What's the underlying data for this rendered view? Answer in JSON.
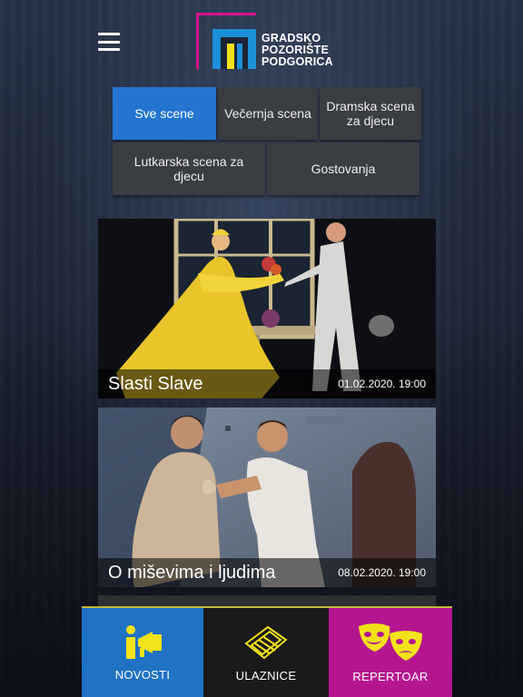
{
  "header": {
    "logo_lines": [
      "GRADSKO",
      "POZORIŠTE",
      "PODGORICA"
    ]
  },
  "filters": {
    "row1": [
      {
        "label": "Sve scene",
        "active": true
      },
      {
        "label": "Večernja scena",
        "active": false
      },
      {
        "label": "Dramska scena za djecu",
        "active": false
      }
    ],
    "row2": [
      {
        "label": "Lutkarska scena za djecu",
        "active": false
      },
      {
        "label": "Gostovanja",
        "active": false
      }
    ]
  },
  "shows": [
    {
      "title": "Slasti Slave",
      "date": "01.02.2020. 19:00"
    },
    {
      "title": "O miševima i ljudima",
      "date": "08.02.2020. 19:00"
    }
  ],
  "tabbar": {
    "news_label": "NOVOSTI",
    "tickets_label": "ULAZNICE",
    "repertoire_label": "REPERTOAR"
  },
  "colors": {
    "accent_blue": "#1f72c4",
    "accent_magenta": "#b5168f",
    "logo_yellow": "#f2e21a",
    "filter_gray": "#3a3d42"
  }
}
